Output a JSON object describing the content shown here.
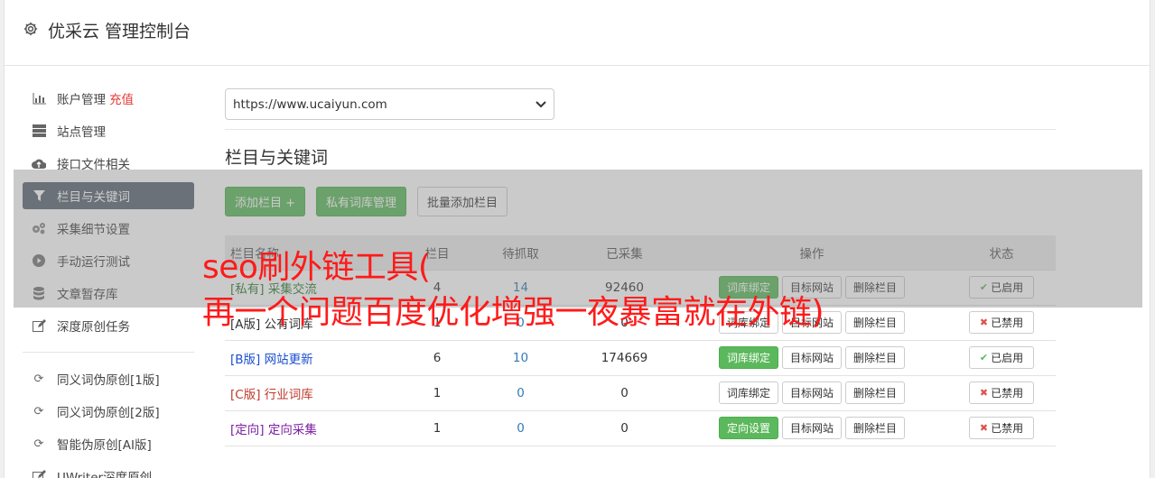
{
  "header": {
    "title": "优采云 管理控制台",
    "icon": "gear-icon"
  },
  "sidebar": {
    "items": [
      {
        "label": "账户管理",
        "extra": "充值",
        "icon": "bar-chart-icon"
      },
      {
        "label": "站点管理",
        "icon": "server-icon"
      },
      {
        "label": "接口文件相关",
        "icon": "cloud-upload-icon"
      },
      {
        "label": "栏目与关键词",
        "icon": "filter-icon",
        "active": true
      },
      {
        "label": "采集细节设置",
        "icon": "cogs-icon"
      },
      {
        "label": "手动运行测试",
        "icon": "play-circle-icon"
      },
      {
        "label": "文章暂存库",
        "icon": "database-icon"
      },
      {
        "label": "深度原创任务",
        "icon": "edit-icon"
      }
    ],
    "items2": [
      {
        "label": "同义词伪原创[1版]",
        "icon": "refresh-icon"
      },
      {
        "label": "同义词伪原创[2版]",
        "icon": "refresh-icon"
      },
      {
        "label": "智能伪原创[AI版]",
        "icon": "refresh-icon"
      },
      {
        "label": "UWriter深度原创",
        "icon": "edit-icon"
      }
    ]
  },
  "main": {
    "site_select": "https://www.ucaiyun.com",
    "section_title": "栏目与关键词",
    "buttons": {
      "add_column": "添加栏目 +",
      "private_lib": "私有词库管理",
      "batch_add": "批量添加栏目"
    },
    "table": {
      "headers": {
        "name": "栏目名称",
        "kw": "栏目",
        "pending": "待抓取",
        "collected": "已采集",
        "ops": "操作",
        "status": "状态"
      },
      "rows": [
        {
          "tag": "[私有]",
          "name": "采集交流",
          "kw": "4",
          "pending": "14",
          "collected": "92460",
          "op1": "词库绑定",
          "op1_green": true,
          "op2": "目标网站",
          "op3": "删除栏目",
          "status": "已启用",
          "on": true
        },
        {
          "tag": "[A版]",
          "name": "公有词库",
          "kw": "1",
          "pending": "0",
          "collected": "0",
          "op1": "词库绑定",
          "op1_green": false,
          "op2": "目标网站",
          "op3": "删除栏目",
          "status": "已禁用",
          "on": false
        },
        {
          "tag": "[B版]",
          "name": "网站更新",
          "kw": "6",
          "pending": "10",
          "collected": "174669",
          "op1": "词库绑定",
          "op1_green": true,
          "op2": "目标网站",
          "op3": "删除栏目",
          "status": "已启用",
          "on": true
        },
        {
          "tag": "[C版]",
          "name": "行业词库",
          "kw": "1",
          "pending": "0",
          "collected": "0",
          "op1": "词库绑定",
          "op1_green": false,
          "op2": "目标网站",
          "op3": "删除栏目",
          "status": "已禁用",
          "on": false
        },
        {
          "tag": "[定向]",
          "name": "定向采集",
          "kw": "1",
          "pending": "0",
          "collected": "0",
          "op1": "定向设置",
          "op1_green": true,
          "op2": "目标网站",
          "op3": "删除栏目",
          "status": "已禁用",
          "on": false
        }
      ]
    }
  },
  "overlay": {
    "line1": "seo刷外链工具(",
    "line2": "再一个问题百度优化增强一夜暴富就在外链)"
  },
  "colors": {
    "green": "#5cb85c",
    "active_nav": "#5b6672",
    "recharge": "#e53935",
    "overlay_text": "#ff1a1a"
  }
}
